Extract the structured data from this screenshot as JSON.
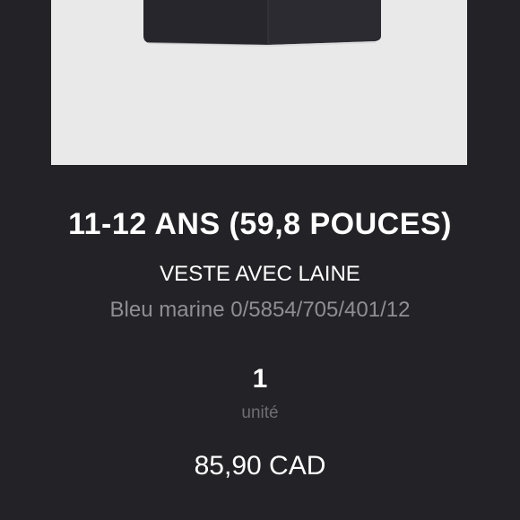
{
  "product": {
    "image_icon": "jacket-image",
    "size": "11-12 ANS (59,8 POUCES)",
    "name": "VESTE AVEC LAINE",
    "reference": "Bleu marine 0/5854/705/401/12",
    "quantity": "1",
    "quantity_unit": "unité",
    "price": "85,90 CAD"
  },
  "colors": {
    "background": "#232327",
    "image_background": "#e9e9e9",
    "garment": "#26262c"
  }
}
